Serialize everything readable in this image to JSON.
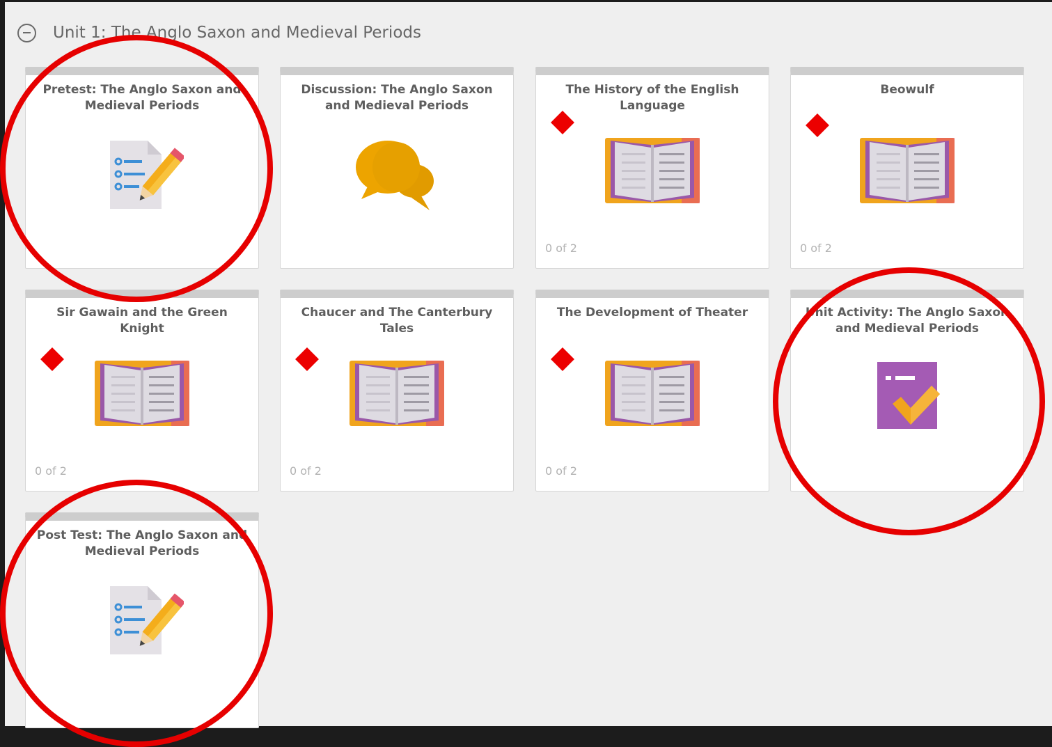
{
  "unit": {
    "title": "Unit 1: The Anglo Saxon and Medieval Periods"
  },
  "cards": [
    {
      "title_line1": "Pretest: The Anglo Saxon and",
      "title_line2": "Medieval Periods",
      "icon": "test-pencil-icon",
      "progress": ""
    },
    {
      "title_line1": "Discussion: The Anglo Saxon",
      "title_line2": "and Medieval Periods",
      "icon": "chat-bubbles-icon",
      "progress": ""
    },
    {
      "title_line1": "The History of the English",
      "title_line2": "Language",
      "icon": "open-book-icon",
      "progress": "0 of 2"
    },
    {
      "title_line1": "Beowulf",
      "title_line2": "",
      "icon": "open-book-icon",
      "progress": "0 of 2"
    },
    {
      "title_line1": "Sir Gawain and the Green",
      "title_line2": "Knight",
      "icon": "open-book-icon",
      "progress": "0 of 2"
    },
    {
      "title_line1": "Chaucer and The Canterbury",
      "title_line2": "Tales",
      "icon": "open-book-icon",
      "progress": "0 of 2"
    },
    {
      "title_line1": "The Development of Theater",
      "title_line2": "",
      "icon": "open-book-icon",
      "progress": "0 of 2"
    },
    {
      "title_line1": "Unit Activity: The Anglo Saxon",
      "title_line2": "and Medieval Periods",
      "icon": "activity-check-icon",
      "progress": ""
    },
    {
      "title_line1": "Post Test: The Anglo Saxon and",
      "title_line2": "Medieval Periods",
      "icon": "test-pencil-icon",
      "progress": ""
    }
  ],
  "colors": {
    "annotation_red": "#e60000",
    "book_orange": "#f0a41d",
    "book_purple": "#9a58a8",
    "chat_orange": "#eda400",
    "activity_purple": "#a45bb4",
    "test_blue": "#3d8fd6"
  }
}
